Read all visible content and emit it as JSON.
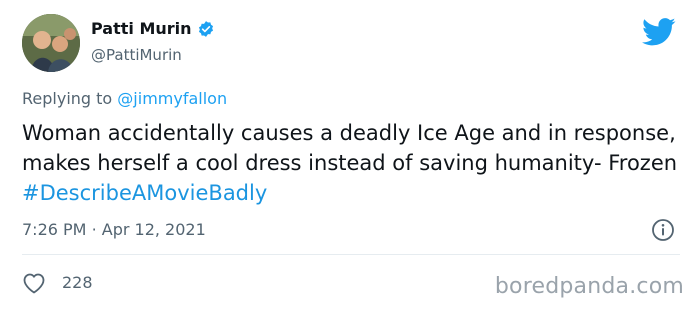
{
  "user": {
    "name": "Patti Murin",
    "handle": "@PattiMurin"
  },
  "reply": {
    "prefix": "Replying to",
    "mention": "@jimmyfallon"
  },
  "tweet": {
    "text": "Woman accidentally causes a deadly Ice Age and in response, makes herself a cool dress instead of saving humanity- Frozen",
    "hashtag": "#DescribeAMovieBadly"
  },
  "meta": {
    "time": "7:26 PM",
    "separator": "·",
    "date": "Apr 12, 2021"
  },
  "stats": {
    "likes": "228"
  },
  "watermark": "boredpanda.com",
  "icons": {
    "verified": "verified-badge-icon",
    "logo": "twitter-bird-icon",
    "info": "info-icon",
    "like": "heart-icon"
  },
  "colors": {
    "accent": "#1da1f2",
    "hashtag": "#1b95e0",
    "secondary_text": "#536471",
    "primary_text": "#0f1419"
  }
}
